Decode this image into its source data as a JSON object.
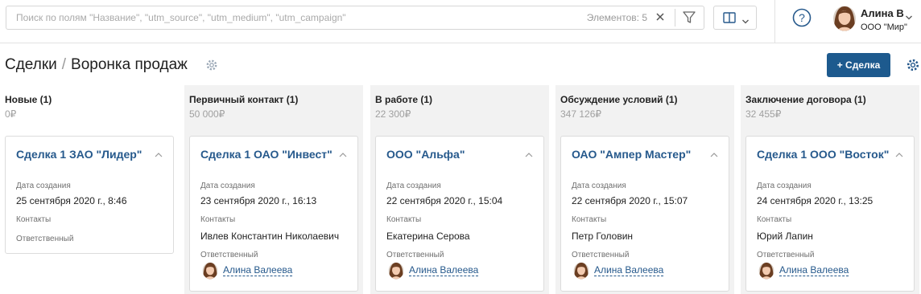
{
  "search": {
    "placeholder": "Поиск по полям \"Название\", \"utm_source\", \"utm_medium\", \"utm_campaign\"",
    "count_text": "Элементов: 5"
  },
  "user": {
    "name": "Алина В",
    "org": "ООО \"Мир\""
  },
  "header": {
    "breadcrumb_root": "Сделки",
    "breadcrumb_sep": "/",
    "breadcrumb_current": "Воронка продаж",
    "add_button": "+ Сделка"
  },
  "labels": {
    "created": "Дата создания",
    "contacts": "Контакты",
    "responsible": "Ответственный"
  },
  "columns": [
    {
      "title": "Новые (1)",
      "sum": "0₽",
      "card": {
        "title": "Сделка 1 ЗАО \"Лидер\"",
        "date": "25 сентября 2020 г., 8:46",
        "contact": "",
        "responsible": ""
      }
    },
    {
      "title": "Первичный контакт (1)",
      "sum": "50 000₽",
      "card": {
        "title": "Сделка 1 ОАО \"Инвест\"",
        "date": "23 сентября 2020 г., 16:13",
        "contact": "Ивлев Константин Николаевич",
        "responsible": "Алина Валеева"
      }
    },
    {
      "title": "В работе (1)",
      "sum": "22 300₽",
      "card": {
        "title": "ООО \"Альфа\"",
        "date": "22 сентября 2020 г., 15:04",
        "contact": "Екатерина Серова",
        "responsible": "Алина Валеева"
      }
    },
    {
      "title": "Обсуждение условий (1)",
      "sum": "347 126₽",
      "card": {
        "title": "ОАО \"Ампер Мастер\"",
        "date": "22 сентября 2020 г., 15:07",
        "contact": "Петр Головин",
        "responsible": "Алина Валеева"
      }
    },
    {
      "title": "Заключение договора (1)",
      "sum": "32 455₽",
      "card": {
        "title": "Сделка 1 ООО \"Восток\"",
        "date": "24 сентября 2020 г., 13:25",
        "contact": "Юрий Лапин",
        "responsible": "Алина Валеева"
      }
    }
  ],
  "colors": {
    "accent": "#1d5a8e",
    "link": "#26598c",
    "column_bg": "#f2f2f2"
  }
}
